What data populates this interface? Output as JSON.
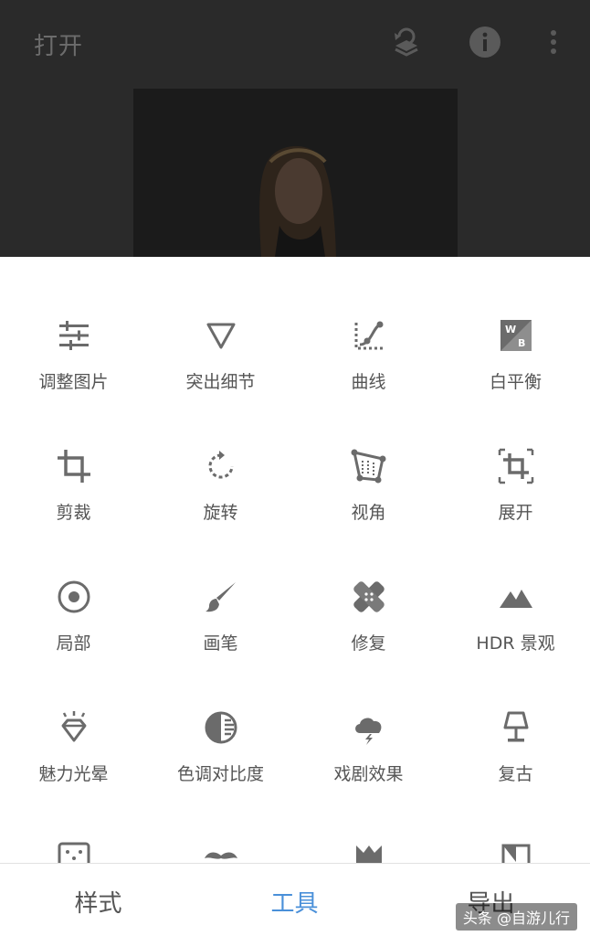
{
  "app": {
    "title": "打开",
    "accent_color": "#4a90d9",
    "icons": [
      "stack-revert-icon",
      "info-icon",
      "more-vert-icon"
    ]
  },
  "photo": {
    "description_icon": "portrait-photo"
  },
  "tools": [
    {
      "label": "调整图片",
      "icon": "tune-sliders-icon"
    },
    {
      "label": "突出细节",
      "icon": "triangle-details-icon"
    },
    {
      "label": "曲线",
      "icon": "curves-icon"
    },
    {
      "label": "白平衡",
      "icon": "white-balance-icon"
    },
    {
      "label": "剪裁",
      "icon": "crop-icon"
    },
    {
      "label": "旋转",
      "icon": "rotate-icon"
    },
    {
      "label": "视角",
      "icon": "perspective-icon"
    },
    {
      "label": "展开",
      "icon": "expand-icon"
    },
    {
      "label": "局部",
      "icon": "selective-icon"
    },
    {
      "label": "画笔",
      "icon": "brush-icon"
    },
    {
      "label": "修复",
      "icon": "healing-icon"
    },
    {
      "label": "HDR 景观",
      "icon": "hdr-landscape-icon"
    },
    {
      "label": "魅力光晕",
      "icon": "glamour-glow-icon"
    },
    {
      "label": "色调对比度",
      "icon": "tonal-contrast-icon"
    },
    {
      "label": "戏剧效果",
      "icon": "drama-icon"
    },
    {
      "label": "复古",
      "icon": "vintage-lamp-icon"
    }
  ],
  "nav": {
    "styles": "样式",
    "tools": "工具",
    "export": "导出"
  },
  "watermark": "头条 @自游儿行"
}
